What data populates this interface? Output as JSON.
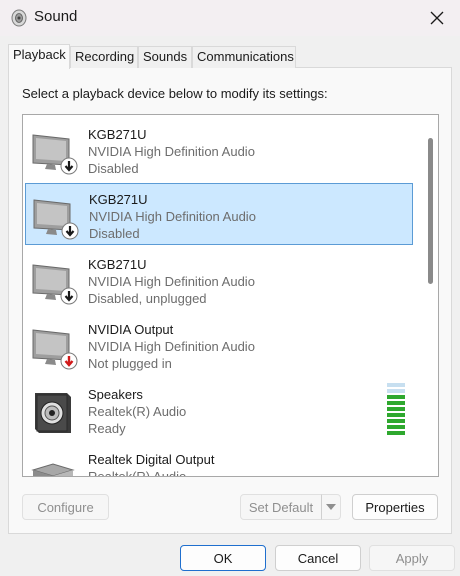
{
  "window": {
    "title": "Sound",
    "icon": "speaker-icon",
    "close_icon": "close-icon"
  },
  "tabs": [
    {
      "label": "Playback",
      "active": true
    },
    {
      "label": "Recording",
      "active": false
    },
    {
      "label": "Sounds",
      "active": false
    },
    {
      "label": "Communications",
      "active": false
    }
  ],
  "instruction": "Select a playback device below to modify its settings:",
  "devices": [
    {
      "name": "KGB271U",
      "driver": "NVIDIA High Definition Audio",
      "status": "Disabled",
      "icon": "monitor-icon",
      "badge": "disabled-arrow-icon",
      "selected": false
    },
    {
      "name": "KGB271U",
      "driver": "NVIDIA High Definition Audio",
      "status": "Disabled",
      "icon": "monitor-icon",
      "badge": "disabled-arrow-icon",
      "selected": true
    },
    {
      "name": "KGB271U",
      "driver": "NVIDIA High Definition Audio",
      "status": "Disabled, unplugged",
      "icon": "monitor-icon",
      "badge": "disabled-arrow-icon",
      "selected": false
    },
    {
      "name": "NVIDIA Output",
      "driver": "NVIDIA High Definition Audio",
      "status": "Not plugged in",
      "icon": "monitor-icon",
      "badge": "unplugged-arrow-icon",
      "selected": false
    },
    {
      "name": "Speakers",
      "driver": "Realtek(R) Audio",
      "status": "Ready",
      "icon": "speaker-box-icon",
      "badge": "",
      "selected": false
    },
    {
      "name": "Realtek Digital Output",
      "driver": "Realtek(R) Audio",
      "status": "",
      "icon": "digital-output-icon",
      "badge": "",
      "selected": false
    }
  ],
  "level_meter": {
    "level": 0.82,
    "active_color": "#2ea82e",
    "inactive_color": "#c7dff0"
  },
  "buttons": {
    "configure": "Configure",
    "set_default": "Set Default",
    "properties": "Properties",
    "ok": "OK",
    "cancel": "Cancel",
    "apply": "Apply"
  },
  "colors": {
    "selection_bg": "#cce8ff",
    "selection_border": "#5b9bd5",
    "accent": "#1f6fce",
    "badge_dark": "#1a1a1a",
    "badge_red": "#d11a1a"
  }
}
